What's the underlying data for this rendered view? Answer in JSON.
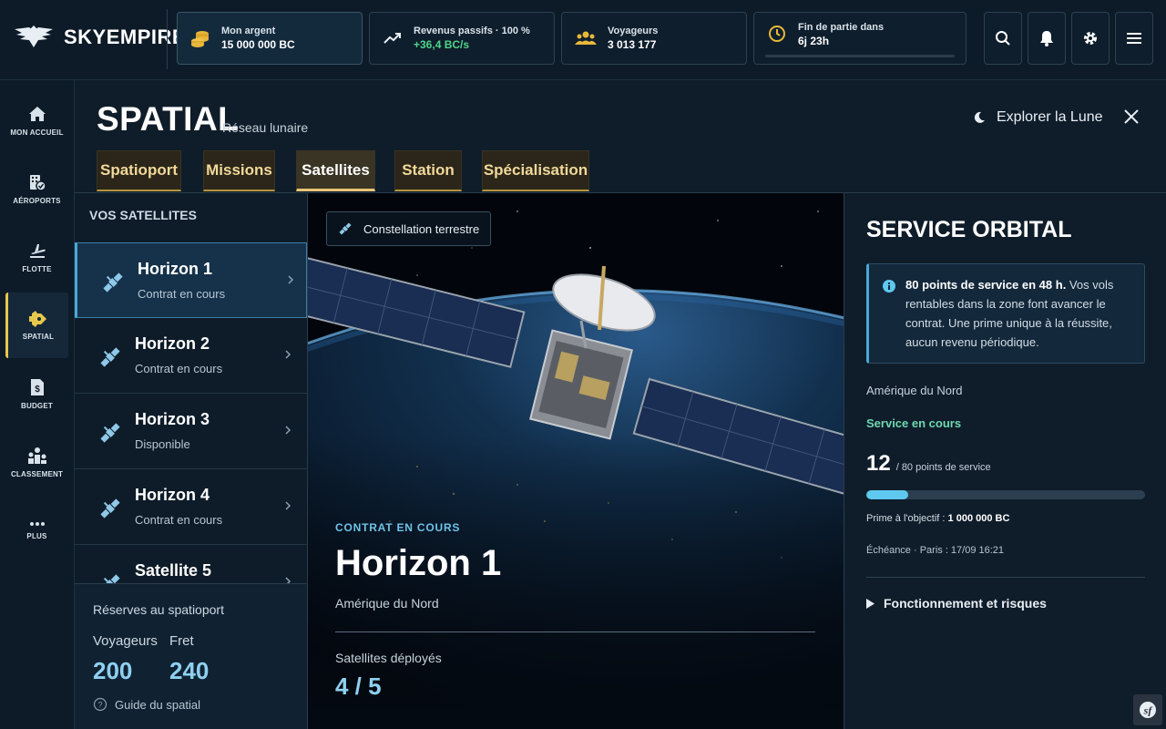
{
  "app": {
    "name": "SKYEMPIRE"
  },
  "topbar": {
    "money": {
      "label": "Mon argent",
      "value": "15 000 000 BC"
    },
    "revenue": {
      "label": "Revenus passifs · 100 %",
      "value": "+36,4 BC/s"
    },
    "travelers": {
      "label": "Voyageurs",
      "value": "3 013 177"
    },
    "endgame": {
      "label": "Fin de partie dans",
      "value": "6j 23h",
      "progress": 0.0
    },
    "icons": [
      "search-icon",
      "bell-icon",
      "gear-icon",
      "menu-icon"
    ]
  },
  "nav": {
    "items": [
      {
        "label": "MON ACCUEIL",
        "icon": "home-icon"
      },
      {
        "label": "AÉROPORTS",
        "icon": "airport-icon"
      },
      {
        "label": "FLOTTE",
        "icon": "plane-icon"
      },
      {
        "label": "SPATIAL",
        "icon": "rocket-icon",
        "active": true
      },
      {
        "label": "BUDGET",
        "icon": "budget-icon"
      },
      {
        "label": "CLASSEMENT",
        "icon": "ranking-icon"
      },
      {
        "label": "PLUS",
        "icon": "more-icon"
      }
    ]
  },
  "header": {
    "title": "SPATIAL",
    "subtitle": "Réseau lunaire",
    "explore": "Explorer la Lune",
    "tabs": [
      {
        "label": "Spatioport"
      },
      {
        "label": "Missions"
      },
      {
        "label": "Satellites",
        "active": true
      },
      {
        "label": "Station"
      },
      {
        "label": "Spécialisation"
      }
    ]
  },
  "satellites": {
    "heading": "VOS SATELLITES",
    "items": [
      {
        "name": "Horizon 1",
        "status": "Contrat en cours",
        "active": true
      },
      {
        "name": "Horizon 2",
        "status": "Contrat en cours"
      },
      {
        "name": "Horizon 3",
        "status": "Disponible"
      },
      {
        "name": "Horizon 4",
        "status": "Contrat en cours"
      },
      {
        "name": "Satellite 5",
        "status": ""
      }
    ],
    "reserves": {
      "title": "Réserves au spatioport",
      "voyageurs_label": "Voyageurs",
      "voyageurs_value": "200",
      "fret_label": "Fret",
      "fret_value": "240",
      "guide": "Guide du spatial"
    }
  },
  "scene": {
    "constellation": "Constellation terrestre",
    "contract_label": "CONTRAT EN COURS",
    "name": "Horizon 1",
    "region": "Amérique du Nord",
    "deployed_label": "Satellites déployés",
    "deployed_value": "4 / 5"
  },
  "service": {
    "title": "SERVICE ORBITAL",
    "info_bold": "80 points de service en 48 h.",
    "info_text": " Vos vols rentables dans la zone font avancer le contrat. Une prime unique à la réussite, aucun revenu périodique.",
    "region": "Amérique du Nord",
    "status": "Service en cours",
    "points": "12",
    "points_total": "/ 80 points de service",
    "progress": 0.15,
    "prime_label": "Prime à l'objectif :",
    "prime_value": "1 000 000 BC",
    "echeance": "Échéance · Paris : 17/09 16:21",
    "fonctionnement": "Fonctionnement et risques"
  },
  "colors": {
    "accent": "#e8c84a",
    "info": "#4aa8d8",
    "success": "#6fd7b0",
    "money": "#e8b83a"
  }
}
